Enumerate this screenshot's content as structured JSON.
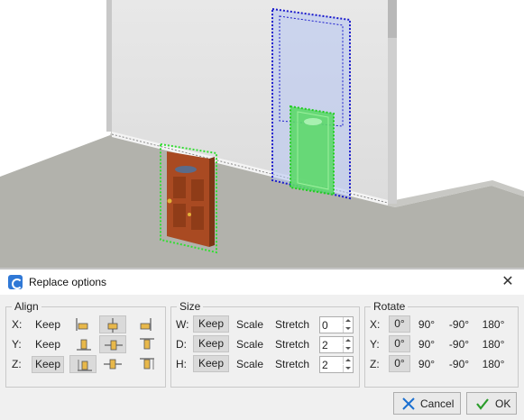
{
  "dialog": {
    "title": "Replace options",
    "close_glyph": "✕"
  },
  "align": {
    "legend": "Align",
    "rows": [
      {
        "axis": "X:",
        "keep": "Keep",
        "selected": "center"
      },
      {
        "axis": "Y:",
        "keep": "Keep",
        "selected": "center"
      },
      {
        "axis": "Z:",
        "keep": "Keep",
        "selected": "keep"
      }
    ]
  },
  "size": {
    "legend": "Size",
    "rows": [
      {
        "axis": "W:",
        "keep": "Keep",
        "scale": "Scale",
        "stretch": "Stretch",
        "value": "0",
        "selected": "keep"
      },
      {
        "axis": "D:",
        "keep": "Keep",
        "scale": "Scale",
        "stretch": "Stretch",
        "value": "2",
        "selected": "keep"
      },
      {
        "axis": "H:",
        "keep": "Keep",
        "scale": "Scale",
        "stretch": "Stretch",
        "value": "2",
        "selected": "keep"
      }
    ]
  },
  "rotate": {
    "legend": "Rotate",
    "rows": [
      {
        "axis": "X:",
        "options": [
          "0°",
          "90°",
          "-90°",
          "180°"
        ],
        "selected": "0°"
      },
      {
        "axis": "Y:",
        "options": [
          "0°",
          "90°",
          "-90°",
          "180°"
        ],
        "selected": "0°"
      },
      {
        "axis": "Z:",
        "options": [
          "0°",
          "90°",
          "-90°",
          "180°"
        ],
        "selected": "0°"
      }
    ]
  },
  "buttons": {
    "cancel": "Cancel",
    "ok": "OK"
  },
  "colors": {
    "accent": "#2f78d6",
    "cancel_icon": "#1a6fd1",
    "ok_icon": "#2a9c2a",
    "selection_green": "#33dd33",
    "selection_blue": "#1a1acc"
  },
  "icons": [
    "app-icon",
    "close-icon",
    "cancel-x-icon",
    "ok-check-icon",
    "align-min-icon",
    "align-center-icon",
    "align-max-icon"
  ]
}
